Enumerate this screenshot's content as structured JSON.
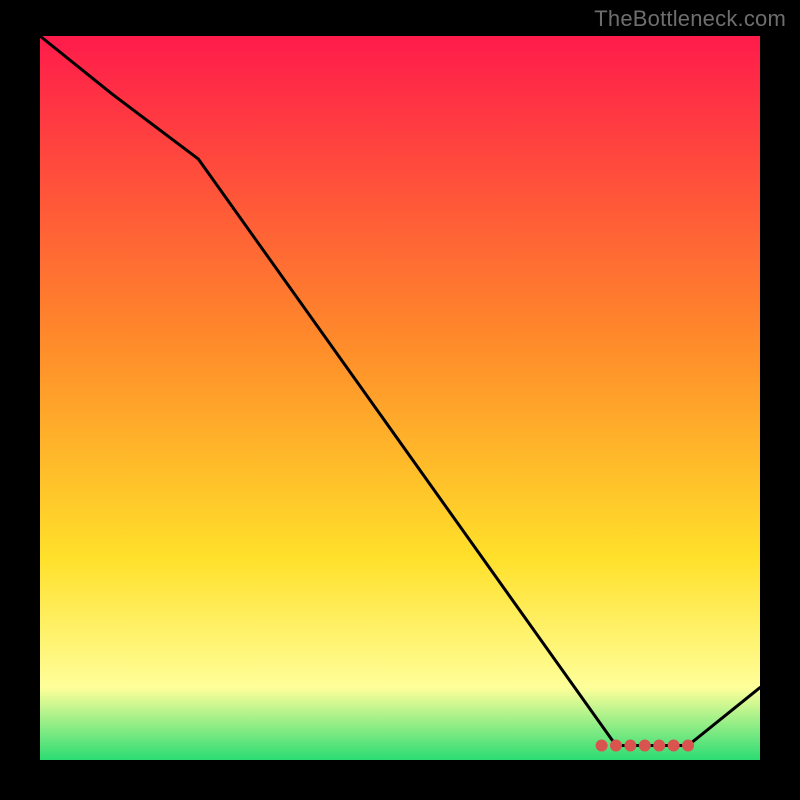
{
  "attribution": "TheBottleneck.com",
  "colors": {
    "background": "#000000",
    "attribution_text": "#6e6e6e",
    "line": "#000000",
    "dot_fill": "#d9534f",
    "gradient_top": "#ff1b4b",
    "gradient_mid1": "#ff8a2a",
    "gradient_mid2": "#ffe02a",
    "gradient_mid3": "#ffff9a",
    "gradient_bottom": "#2bdc73"
  },
  "chart_data": {
    "type": "line",
    "title": "",
    "xlabel": "",
    "ylabel": "",
    "xlim": [
      0,
      100
    ],
    "ylim": [
      0,
      100
    ],
    "grid": false,
    "legend": false,
    "series": [
      {
        "name": "curve",
        "x": [
          0,
          10,
          22,
          80,
          90,
          100
        ],
        "y": [
          100,
          92,
          83,
          2,
          2,
          10
        ]
      }
    ],
    "highlight_points": {
      "name": "optimal-range",
      "x": [
        78,
        80,
        82,
        84,
        86,
        88,
        90
      ],
      "y": [
        2,
        2,
        2,
        2,
        2,
        2,
        2
      ]
    }
  }
}
